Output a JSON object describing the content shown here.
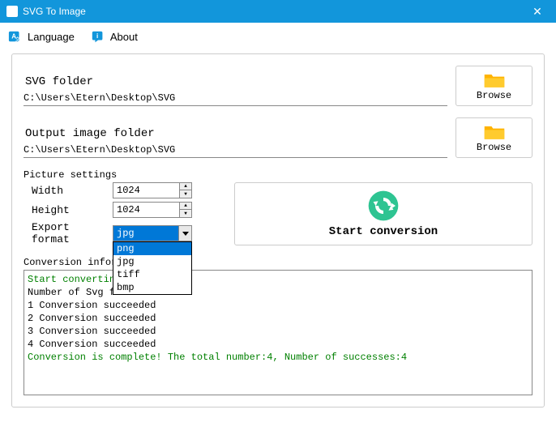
{
  "window": {
    "title": "SVG To Image"
  },
  "menu": {
    "language": "Language",
    "about": "About"
  },
  "svg_folder": {
    "label": "SVG folder",
    "path": "C:\\Users\\Etern\\Desktop\\SVG",
    "browse": "Browse"
  },
  "output_folder": {
    "label": "Output image folder",
    "path": "C:\\Users\\Etern\\Desktop\\SVG",
    "browse": "Browse"
  },
  "settings": {
    "legend": "Picture settings",
    "width_label": "Width",
    "width_value": "1024",
    "height_label": "Height",
    "height_value": "1024",
    "format_label": "Export format",
    "format_value": "jpg",
    "format_options": [
      "png",
      "jpg",
      "tiff",
      "bmp"
    ]
  },
  "start_label": "Start conversion",
  "log": {
    "label": "Conversion information",
    "lines": [
      {
        "text": "Start converting...",
        "cls": "log-green"
      },
      {
        "text": "Number of Svg files: 4",
        "cls": ""
      },
      {
        "text": "1 Conversion succeeded",
        "cls": ""
      },
      {
        "text": "2 Conversion succeeded",
        "cls": ""
      },
      {
        "text": "3 Conversion succeeded",
        "cls": ""
      },
      {
        "text": "4 Conversion succeeded",
        "cls": ""
      },
      {
        "text": "Conversion is complete! The total number:4, Number of successes:4",
        "cls": "log-green"
      }
    ]
  }
}
